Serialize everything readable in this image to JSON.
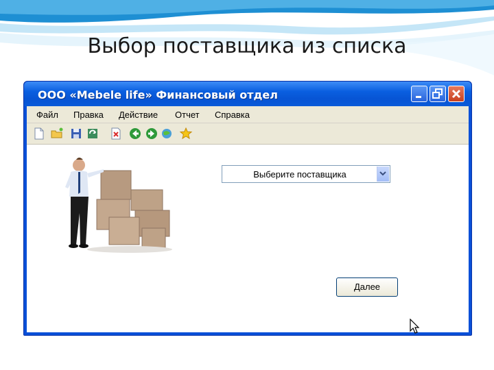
{
  "slide": {
    "title": "Выбор поставщика из списка"
  },
  "window": {
    "title": "ООО «Mebele life» Финансовый отдел",
    "buttons": [
      "minimize-icon",
      "maximize-icon",
      "close-icon"
    ]
  },
  "menu": {
    "items": [
      {
        "label": "Файл"
      },
      {
        "label": "Правка"
      },
      {
        "label": "Действие"
      },
      {
        "label": "Отчет"
      },
      {
        "label": "Справка"
      }
    ]
  },
  "toolbar": {
    "icons": [
      "new-document-icon",
      "open-folder-icon",
      "save-icon",
      "refresh-icon",
      "delete-icon",
      "back-icon",
      "forward-icon",
      "search-web-icon",
      "favorites-icon"
    ]
  },
  "main": {
    "supplier_select": {
      "placeholder": "Выберите поставщика"
    },
    "next_button": "Далее",
    "image": "man-with-boxes-picture"
  },
  "colors": {
    "titlebar": "#0a5fe0",
    "menubar": "#ece9d8",
    "slide_wave": "#1e9bd7"
  }
}
